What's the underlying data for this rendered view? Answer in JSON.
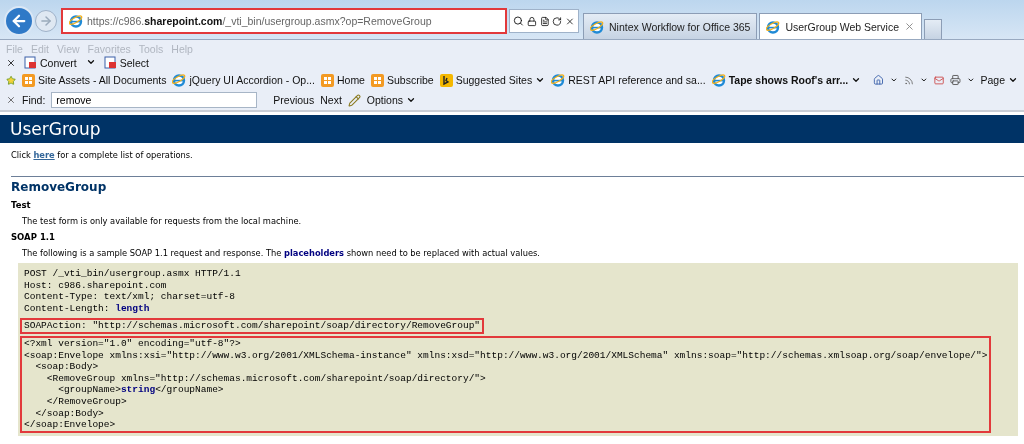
{
  "address_bar": {
    "url": "https://c986.**sharepoint.com**/_vti_bin/usergroup.asmx?op=RemoveGroup",
    "highlighted": true
  },
  "tabs": [
    {
      "label": "Nintex Workflow for Office 365",
      "selected": false
    },
    {
      "label": "UserGroup Web Service",
      "selected": true
    }
  ],
  "menu_bar": [
    "File",
    "Edit",
    "View",
    "Favorites",
    "Tools",
    "Help"
  ],
  "toolbar": [
    {
      "label": "Convert",
      "dropdown": true
    },
    {
      "label": "Select",
      "dropdown": false
    }
  ],
  "favorites_bar": [
    {
      "label": "Site Assets - All Documents",
      "kind": "site",
      "dropdown": false,
      "bold": false
    },
    {
      "label": "jQuery UI Accordion - Op...",
      "kind": "ie",
      "dropdown": false,
      "bold": false
    },
    {
      "label": "Home",
      "kind": "site",
      "dropdown": false,
      "bold": false
    },
    {
      "label": "Subscribe",
      "kind": "site",
      "dropdown": false,
      "bold": false
    },
    {
      "label": "Suggested Sites",
      "kind": "bing",
      "dropdown": true,
      "bold": false
    },
    {
      "label": "REST API reference and sa...",
      "kind": "ie",
      "dropdown": false,
      "bold": false
    },
    {
      "label": "Tape shows Roof's arr...",
      "kind": "ie",
      "dropdown": true,
      "bold": true
    }
  ],
  "command_bar": {
    "page_label": "Page"
  },
  "find_bar": {
    "label": "Find:",
    "value": "remove",
    "previous": "Previous",
    "next": "Next",
    "options": "Options"
  },
  "page": {
    "header": "UserGroup",
    "intro": [
      {
        "text": "Click ",
        "kind": "text"
      },
      {
        "text": "here",
        "kind": "link"
      },
      {
        "text": " for a complete list of operations.",
        "kind": "text"
      }
    ],
    "operation": "RemoveGroup",
    "sections": [
      {
        "heading": "Test",
        "text": "The test form is only available for requests from the local machine."
      },
      {
        "heading": "SOAP 1.1",
        "text": "The following is a sample SOAP 1.1 request and response. The **placeholders** shown need to be replaced with actual values."
      }
    ],
    "code_blocks": [
      {
        "highlighted": false,
        "lines": [
          [
            {
              "text": "POST /_vti_bin/usergroup.asmx HTTP/1.1",
              "kind": "plain"
            }
          ],
          [
            {
              "text": "Host: c986.sharepoint.com",
              "kind": "plain"
            }
          ],
          [
            {
              "text": "Content-Type: text/xml; charset=utf-8",
              "kind": "plain"
            }
          ],
          [
            {
              "text": "Content-Length: ",
              "kind": "plain"
            },
            {
              "text": "length",
              "kind": "placeholder"
            }
          ]
        ]
      },
      {
        "highlighted": true,
        "lines": [
          [
            {
              "text": "SOAPAction: \"http://schemas.microsoft.com/sharepoint/soap/directory/RemoveGroup\"",
              "kind": "plain"
            }
          ]
        ]
      },
      {
        "highlighted": true,
        "lines": [
          [
            {
              "text": "<?xml version=\"1.0\" encoding=\"utf-8\"?>",
              "kind": "plain"
            }
          ],
          [
            {
              "text": "<soap:Envelope xmlns:xsi=\"http://www.w3.org/2001/XMLSchema-instance\" xmlns:xsd=\"http://www.w3.org/2001/XMLSchema\" xmlns:soap=\"http://schemas.xmlsoap.org/soap/envelope/\">",
              "kind": "plain"
            }
          ],
          [
            {
              "text": "  <soap:Body>",
              "kind": "plain"
            }
          ],
          [
            {
              "text": "    <RemoveGroup xmlns=\"http://schemas.microsoft.com/sharepoint/soap/directory/\">",
              "kind": "plain"
            }
          ],
          [
            {
              "text": "      <groupName>",
              "kind": "plain"
            },
            {
              "text": "string",
              "kind": "placeholder"
            },
            {
              "text": "</groupName>",
              "kind": "plain"
            }
          ],
          [
            {
              "text": "    </RemoveGroup>",
              "kind": "plain"
            }
          ],
          [
            {
              "text": "  </soap:Body>",
              "kind": "plain"
            }
          ],
          [
            {
              "text": "</soap:Envelope>",
              "kind": "plain"
            }
          ]
        ]
      }
    ]
  }
}
